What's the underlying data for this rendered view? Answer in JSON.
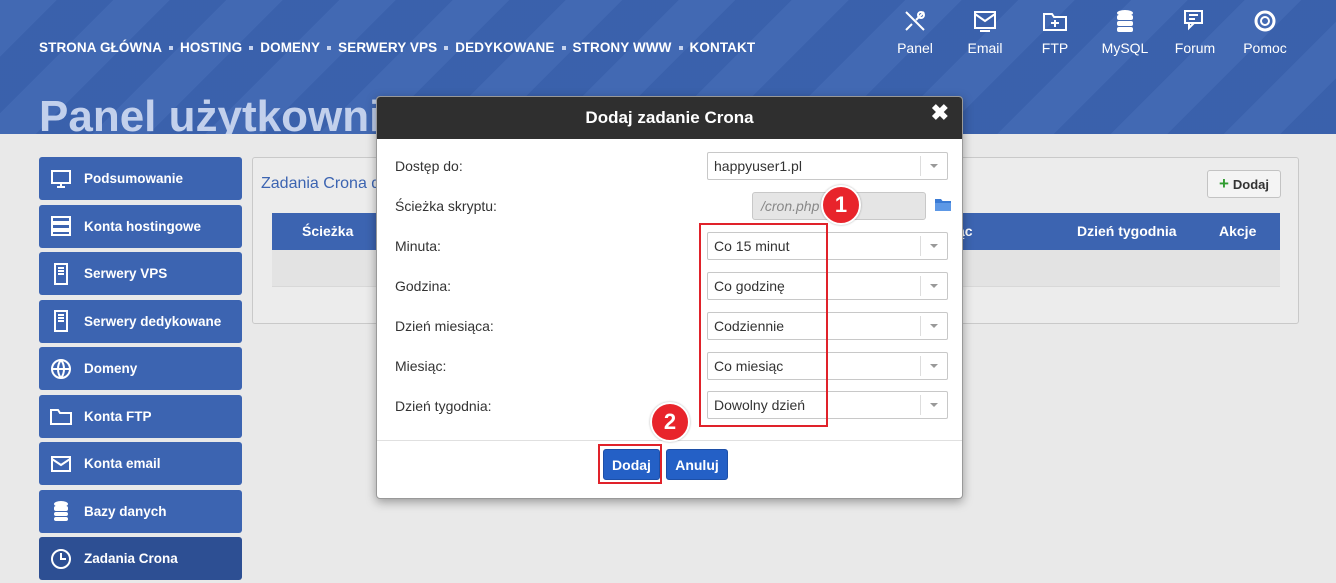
{
  "topnav": {
    "items": [
      "STRONA GŁÓWNA",
      "HOSTING",
      "DOMENY",
      "SERWERY VPS",
      "DEDYKOWANE",
      "STRONY WWW",
      "KONTAKT"
    ]
  },
  "topicons": [
    {
      "label": "Panel",
      "icon": "tools-icon"
    },
    {
      "label": "Email",
      "icon": "email-icon"
    },
    {
      "label": "FTP",
      "icon": "ftp-icon"
    },
    {
      "label": "MySQL",
      "icon": "database-icon"
    },
    {
      "label": "Forum",
      "icon": "forum-icon"
    },
    {
      "label": "Pomoc",
      "icon": "lifebuoy-icon"
    }
  ],
  "page_title": "Panel użytkownika",
  "sidebar": {
    "items": [
      {
        "label": "Podsumowanie",
        "icon": "monitor-icon"
      },
      {
        "label": "Konta hostingowe",
        "icon": "server-icon"
      },
      {
        "label": "Serwery VPS",
        "icon": "tower-icon"
      },
      {
        "label": "Serwery dedykowane",
        "icon": "tower-icon"
      },
      {
        "label": "Domeny",
        "icon": "globe-icon"
      },
      {
        "label": "Konta FTP",
        "icon": "folder-icon"
      },
      {
        "label": "Konta email",
        "icon": "envelope-icon"
      },
      {
        "label": "Bazy danych",
        "icon": "database-icon"
      },
      {
        "label": "Zadania Crona",
        "icon": "clock-icon"
      }
    ],
    "active": "Zadania Crona"
  },
  "content": {
    "title": "Zadania Crona dla",
    "add_label": "Dodaj",
    "columns": {
      "path": "Ścieżka",
      "month": "Miesiąc",
      "weekday": "Dzień tygodnia",
      "actions": "Akcje"
    }
  },
  "modal": {
    "title": "Dodaj zadanie Crona",
    "close": "✖",
    "fields": {
      "access": {
        "label": "Dostęp do:",
        "value": "happyuser1.pl"
      },
      "path": {
        "label": "Ścieżka skryptu:",
        "placeholder": "/cron.php"
      },
      "minute": {
        "label": "Minuta:",
        "value": "Co 15 minut"
      },
      "hour": {
        "label": "Godzina:",
        "value": "Co godzinę"
      },
      "day": {
        "label": "Dzień miesiąca:",
        "value": "Codziennie"
      },
      "month": {
        "label": "Miesiąc:",
        "value": "Co miesiąc"
      },
      "weekday": {
        "label": "Dzień tygodnia:",
        "value": "Dowolny dzień"
      }
    },
    "submit_label": "Dodaj",
    "cancel_label": "Anuluj"
  },
  "annotations": {
    "badge1": "1",
    "badge2": "2"
  },
  "colors": {
    "brand": "#3c64b1",
    "highlight": "#e0222a",
    "button": "#2460c6"
  }
}
